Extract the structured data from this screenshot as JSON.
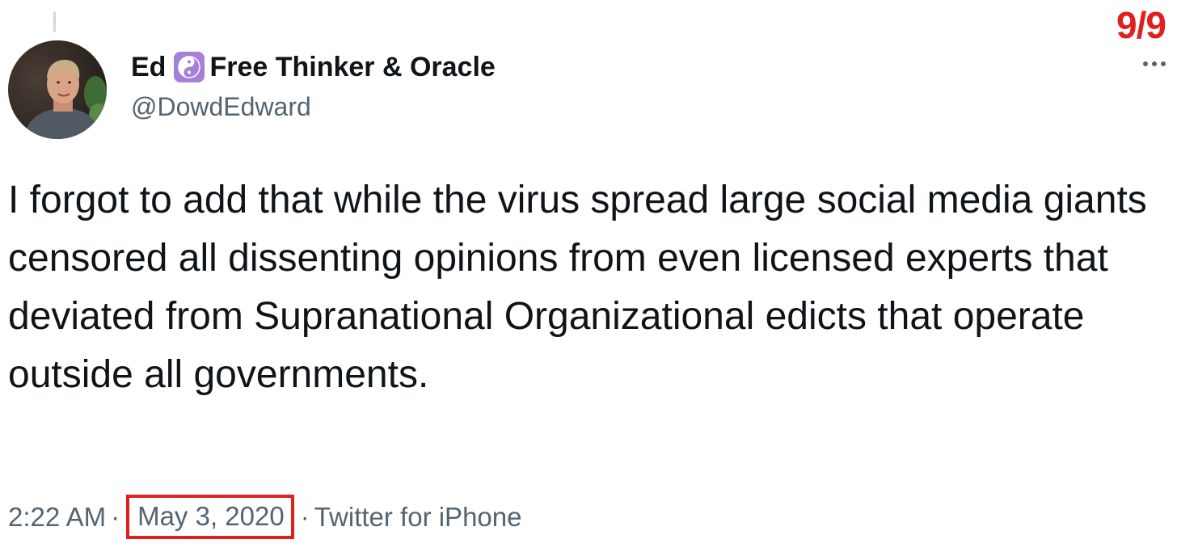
{
  "page_counter": "9/9",
  "author": {
    "display_name": "Ed",
    "display_name_suffix": "Free Thinker & Oracle",
    "name_emoji": "yin-yang-icon",
    "handle": "@DowdEdward"
  },
  "tweet": {
    "text": "I forgot to add that while the virus spread large social media giants censored all dissenting opinions from even licensed experts that deviated from Supranational Organizational edicts that operate outside all governments."
  },
  "meta": {
    "time": "2:22 AM",
    "separator": "·",
    "date": "May 3, 2020",
    "source": "Twitter for iPhone"
  },
  "colors": {
    "accent_red": "#e0201c",
    "emoji_purple": "#a47fdc",
    "text_primary": "#0f1419",
    "text_secondary": "#536471"
  }
}
